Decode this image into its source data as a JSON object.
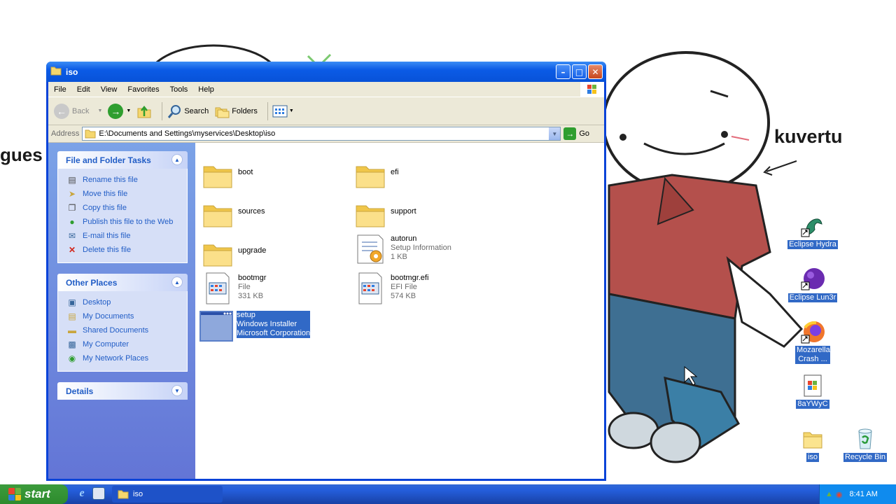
{
  "wallpaper": {
    "left_text": "gues",
    "right_text": "kuvertu"
  },
  "desktop_icons": [
    {
      "label": "Eclipse Hydra",
      "icon": "hydra-icon"
    },
    {
      "label": "Eclipse Lun3r",
      "icon": "purple-orb-icon"
    },
    {
      "label": "Mozarella Crash ...",
      "icon": "firefox-icon"
    },
    {
      "label": "8aYWyC",
      "icon": "document-icon"
    },
    {
      "label": "iso",
      "icon": "folder-icon"
    },
    {
      "label": "Recycle Bin",
      "icon": "recycle-bin-icon"
    }
  ],
  "window": {
    "title": "iso",
    "menu": [
      "File",
      "Edit",
      "View",
      "Favorites",
      "Tools",
      "Help"
    ],
    "toolbar": {
      "back_label": "Back",
      "search_label": "Search",
      "folders_label": "Folders"
    },
    "address": {
      "label": "Address",
      "value": "E:\\Documents and Settings\\myservices\\Desktop\\iso",
      "go_label": "Go"
    },
    "task_pane": {
      "file_tasks": {
        "title": "File and Folder Tasks",
        "items": [
          "Rename this file",
          "Move this file",
          "Copy this file",
          "Publish this file to the Web",
          "E-mail this file",
          "Delete this file"
        ]
      },
      "other_places": {
        "title": "Other Places",
        "items": [
          "Desktop",
          "My Documents",
          "Shared Documents",
          "My Computer",
          "My Network Places"
        ]
      },
      "details": {
        "title": "Details"
      }
    },
    "files": [
      {
        "name": "boot",
        "line2": "",
        "line3": "",
        "type": "folder"
      },
      {
        "name": "efi",
        "line2": "",
        "line3": "",
        "type": "folder"
      },
      {
        "name": "sources",
        "line2": "",
        "line3": "",
        "type": "folder"
      },
      {
        "name": "support",
        "line2": "",
        "line3": "",
        "type": "folder"
      },
      {
        "name": "upgrade",
        "line2": "",
        "line3": "",
        "type": "folder"
      },
      {
        "name": "autorun",
        "line2": "Setup Information",
        "line3": "1 KB",
        "type": "inf"
      },
      {
        "name": "bootmgr",
        "line2": "File",
        "line3": "331 KB",
        "type": "file"
      },
      {
        "name": "bootmgr.efi",
        "line2": "EFI File",
        "line3": "574 KB",
        "type": "file"
      },
      {
        "name": "setup",
        "line2": "Windows Installer",
        "line3": "Microsoft Corporation",
        "type": "exe",
        "selected": true
      }
    ]
  },
  "taskbar": {
    "start_label": "start",
    "task_label": "iso",
    "clock": "8:41 AM"
  }
}
